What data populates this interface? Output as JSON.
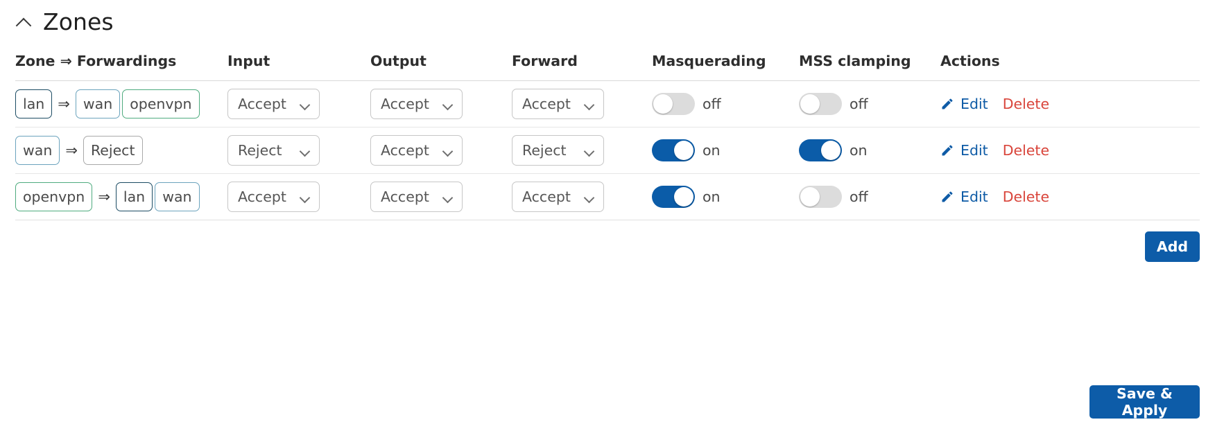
{
  "section": {
    "title": "Zones",
    "collapse_icon": "chevron-up-icon"
  },
  "table": {
    "headers": {
      "zone": "Zone ⇒ Forwardings",
      "input": "Input",
      "output": "Output",
      "forward": "Forward",
      "masquerading": "Masquerading",
      "mss_clamping": "MSS clamping",
      "actions": "Actions"
    },
    "arrow_glyph": "⇒",
    "rows": [
      {
        "source_zone": "lan",
        "source_kind": "lan",
        "forwardings": [
          {
            "label": "wan",
            "kind": "wan"
          },
          {
            "label": "openvpn",
            "kind": "openvpn"
          }
        ],
        "input": "Accept",
        "output": "Accept",
        "forward": "Accept",
        "masquerading": {
          "state": "off",
          "on": false
        },
        "mss_clamping": {
          "state": "off",
          "on": false
        },
        "edit_label": "Edit",
        "delete_label": "Delete"
      },
      {
        "source_zone": "wan",
        "source_kind": "wan",
        "forwardings": [
          {
            "label": "Reject",
            "kind": "reject"
          }
        ],
        "input": "Reject",
        "output": "Accept",
        "forward": "Reject",
        "masquerading": {
          "state": "on",
          "on": true
        },
        "mss_clamping": {
          "state": "on",
          "on": true
        },
        "edit_label": "Edit",
        "delete_label": "Delete"
      },
      {
        "source_zone": "openvpn",
        "source_kind": "openvpn",
        "forwardings": [
          {
            "label": "lan",
            "kind": "lan"
          },
          {
            "label": "wan",
            "kind": "wan"
          }
        ],
        "input": "Accept",
        "output": "Accept",
        "forward": "Accept",
        "masquerading": {
          "state": "on",
          "on": true
        },
        "mss_clamping": {
          "state": "off",
          "on": false
        },
        "edit_label": "Edit",
        "delete_label": "Delete"
      }
    ]
  },
  "buttons": {
    "add": "Add",
    "save_apply": "Save & Apply"
  },
  "colors": {
    "primary": "#0d5ca8",
    "toggle_on": "#0b5ca8",
    "toggle_off": "#dcdcdc",
    "edit_link": "#0e5ba6",
    "delete_link": "#d9453b",
    "badge_lan": "#1b4b63",
    "badge_wan": "#6ba3bd",
    "badge_openvpn": "#4eab7e",
    "badge_reject": "#a9a9a9"
  }
}
